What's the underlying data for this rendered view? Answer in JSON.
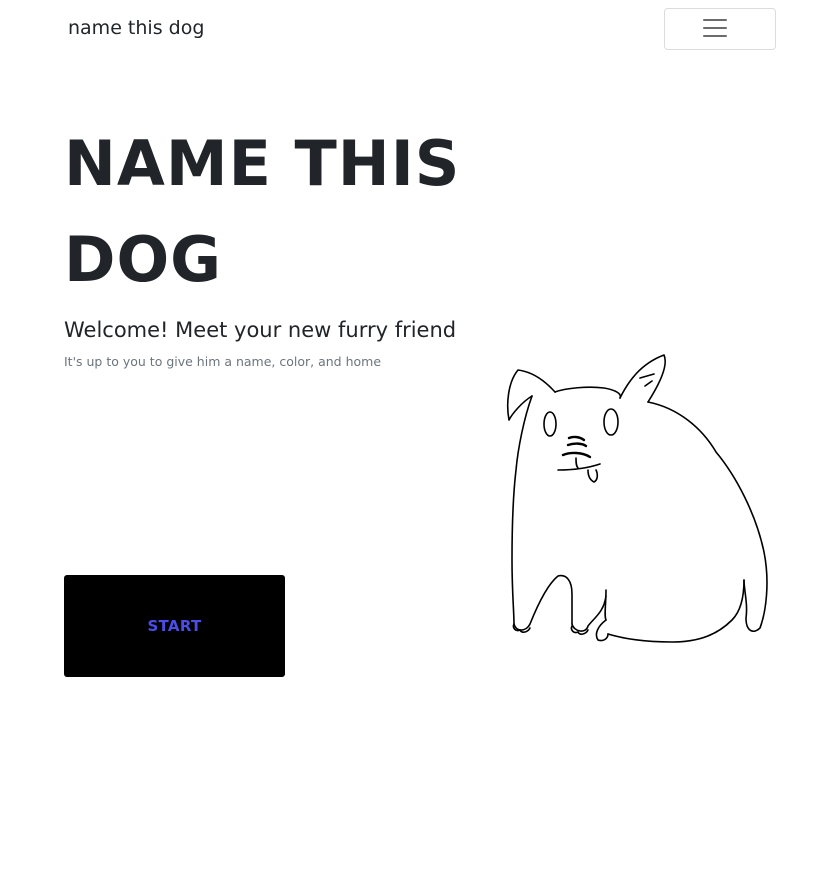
{
  "navbar": {
    "brand": "name this dog",
    "toggle_icon": "hamburger-menu-icon"
  },
  "hero": {
    "title": "NAME THIS DOG",
    "welcome": "Welcome! Meet your new furry friend",
    "subtitle": "It's up to you to give him a name, color, and home",
    "start_label": "START"
  },
  "illustration": {
    "icon": "dog-drawing"
  },
  "colors": {
    "start_button_bg": "#000000",
    "start_button_text": "#4b4de6",
    "heading": "#212529",
    "muted": "#6c757d"
  }
}
